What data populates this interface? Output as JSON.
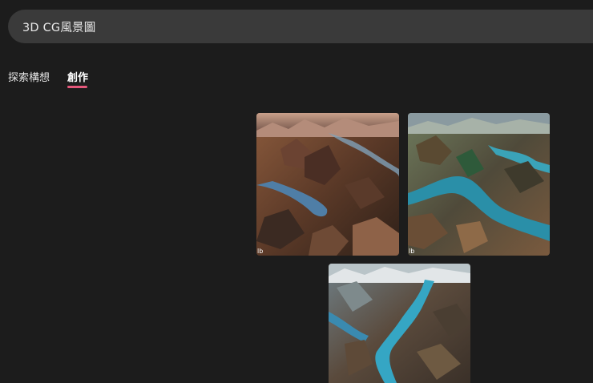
{
  "search": {
    "query": "3D CG風景圖"
  },
  "tabs": [
    {
      "label": "探索構想",
      "active": false
    },
    {
      "label": "創作",
      "active": true
    }
  ],
  "accent_color": "#e4577a",
  "results": [
    {
      "badge": "lb",
      "alt": "aerial 3D landscape with mountains and rivers, warm sunset tones"
    },
    {
      "badge": "lb",
      "alt": "aerial 3D landscape with turquoise rivers and green mountains"
    },
    {
      "badge": "",
      "alt": "aerial 3D landscape with blue river and snowy peaks"
    }
  ]
}
